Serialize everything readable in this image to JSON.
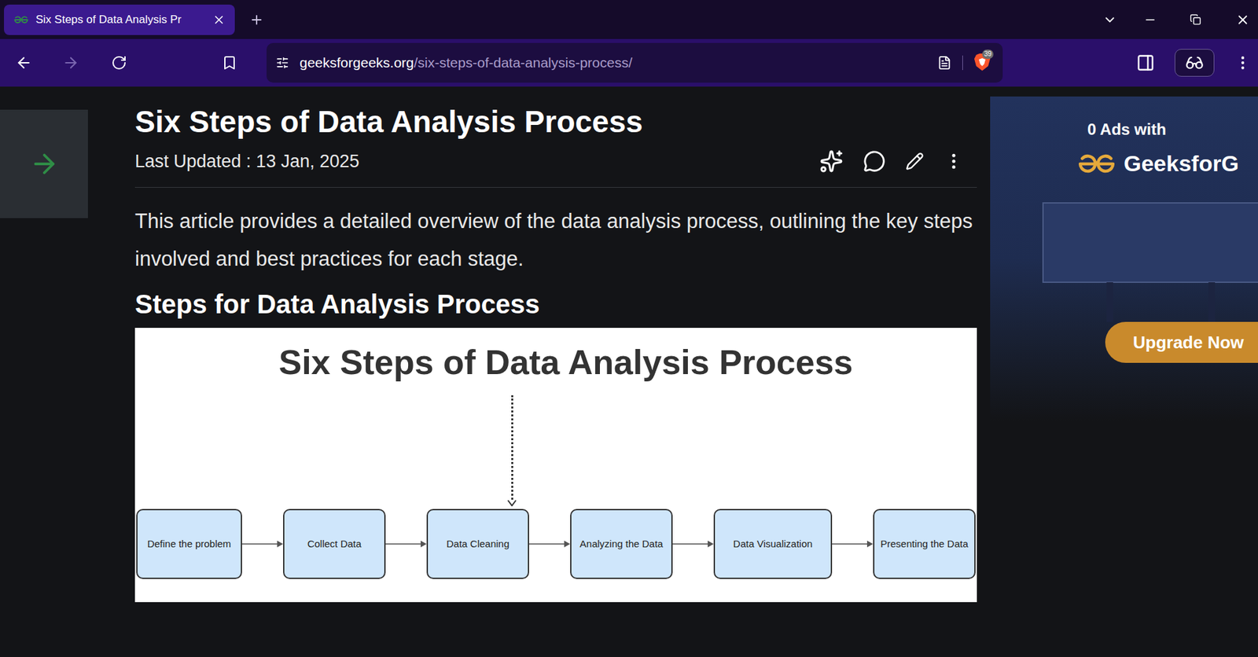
{
  "window": {
    "title": "Six Steps of Data Analysis Pr"
  },
  "tabs": [
    {
      "label": "Six Steps of Data Analysis Pr",
      "selected": true
    }
  ],
  "nav": {
    "back_enabled": true,
    "forward_enabled": false
  },
  "address": {
    "host": "geeksforgeeks.org",
    "path": "/six-steps-of-data-analysis-process/",
    "shields_badge": "39"
  },
  "article": {
    "title": "Six Steps of Data Analysis Process",
    "updated": "Last Updated : 13 Jan, 2025",
    "intro": "This article provides a detailed overview of the data analysis process, outlining the key steps involved and best practices for each stage.",
    "heading": "Steps for Data Analysis Process",
    "diagram": {
      "title": "Six Steps of Data Analysis Process",
      "steps": [
        "Define the problem",
        "Collect Data",
        "Data Cleaning",
        "Analyzing the Data",
        "Data Visualization",
        "Presenting the Data"
      ]
    }
  },
  "ad": {
    "line1": "0 Ads with",
    "brand": "GeeksforG",
    "button": "Upgrade Now"
  }
}
